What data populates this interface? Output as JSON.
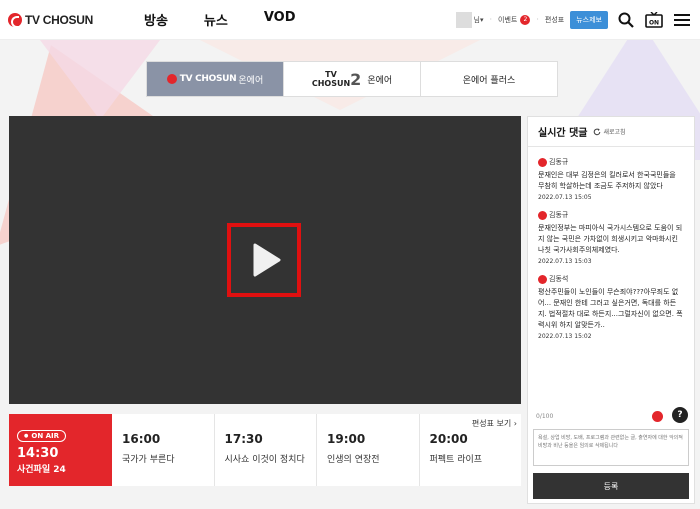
{
  "header": {
    "logo_text": "TV CHOSUN",
    "nav": [
      "방송",
      "뉴스",
      "VOD"
    ],
    "user_suffix": "님",
    "event_label": "이벤트",
    "event_badge": "2",
    "schedule_label": "편성표",
    "report_label": "뉴스제보",
    "onair_icon_text": "ON"
  },
  "channel_tabs": [
    {
      "brand": "TV CHOSUN",
      "label": "온에어",
      "active": true
    },
    {
      "brand_line1": "TV",
      "brand_line2": "CHOSUN",
      "brand_num": "2",
      "label": "온에어",
      "active": false
    },
    {
      "label": "온에어 플러스",
      "active": false
    }
  ],
  "schedule": {
    "view_link": "편성표 보기",
    "onair": {
      "badge": "ON AIR",
      "time": "14:30",
      "title": "사건파일 24"
    },
    "items": [
      {
        "time": "16:00",
        "title": "국가가 부른다"
      },
      {
        "time": "17:30",
        "title": "시사쇼 이것이 정치다"
      },
      {
        "time": "19:00",
        "title": "인생의 연장전"
      },
      {
        "time": "20:00",
        "title": "퍼펙트 라이프"
      }
    ]
  },
  "comments": {
    "title": "실시간 댓글",
    "refresh": "새로고침",
    "list": [
      {
        "author": "김동규",
        "body": "문재인은 대부 김정은의 킬러로서 한국국민들을 무참히 학살하는데 조금도 주저하지 않았다",
        "date": "2022.07.13 15:05"
      },
      {
        "author": "김동규",
        "body": "문재인정부는 마피아식 국가시스템으로 도움이 되지 않는 국민은 가차없이 희생시키고 악마화시킨 나칫 국가사회주의체제였다.",
        "date": "2022.07.13 15:03"
      },
      {
        "author": "김동석",
        "body": "평산주민들이 노인들이 무슨죄야???아무죄도 없어... 문재인 한테 그러고 싶은거면, 독대를 하든지. 법적절차 대로 하든지...그럴자신이 없으면. 폭력시위 하지 알맞든가..",
        "date": "2022.07.13 15:02"
      }
    ],
    "counter": "0/100",
    "input_placeholder": "욕설, 상업 비방, 도배, 프로그램과 관련없는 글, 출연자에 대한 악의적 비방과 비난 등을은 임의로 삭제됩니다",
    "submit": "등록"
  }
}
